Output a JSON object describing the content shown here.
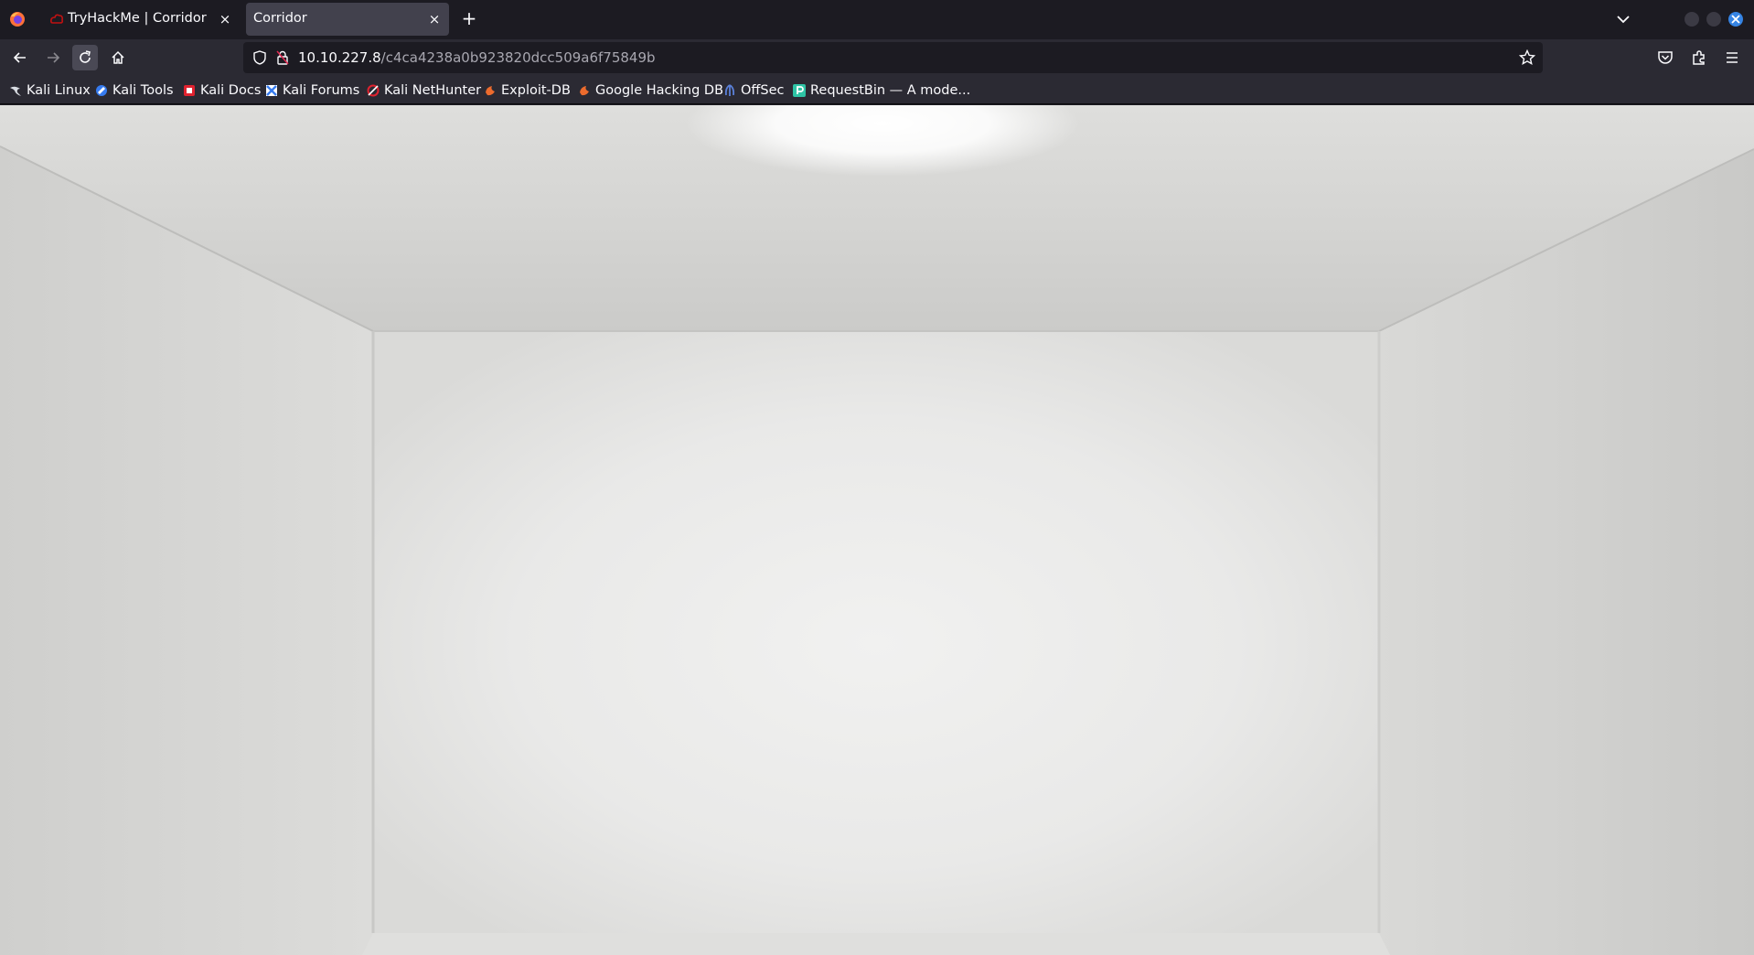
{
  "browser": {
    "tabs": [
      {
        "label": "TryHackMe | Corridor",
        "icon": "tryhackme-icon",
        "active": false
      },
      {
        "label": "Corridor",
        "icon": "none",
        "active": true
      }
    ],
    "new_tab_symbol": "+",
    "close_symbol": "×"
  },
  "address_bar": {
    "host": "10.10.227.8",
    "path": "/c4ca4238a0b923820dcc509a6f75849b"
  },
  "bookmarks": [
    {
      "label": "Kali Linux",
      "icon": "kali-dragon-icon"
    },
    {
      "label": "Kali Tools",
      "icon": "kali-tools-icon"
    },
    {
      "label": "Kali Docs",
      "icon": "kali-docs-icon"
    },
    {
      "label": "Kali Forums",
      "icon": "kali-forums-icon"
    },
    {
      "label": "Kali NetHunter",
      "icon": "nethunter-icon"
    },
    {
      "label": "Exploit-DB",
      "icon": "exploit-db-icon"
    },
    {
      "label": "Google Hacking DB",
      "icon": "ghdb-icon"
    },
    {
      "label": "OffSec",
      "icon": "offsec-icon"
    },
    {
      "label": "RequestBin — A mode...",
      "icon": "requestbin-icon"
    }
  ],
  "theme": {
    "tab_strip": "#1c1b22",
    "toolbar": "#2b2a33",
    "active_tab": "#42414d",
    "text": "#fbfbfe",
    "window_close": "#3584e4",
    "room_wall": "#e6e6e4"
  }
}
